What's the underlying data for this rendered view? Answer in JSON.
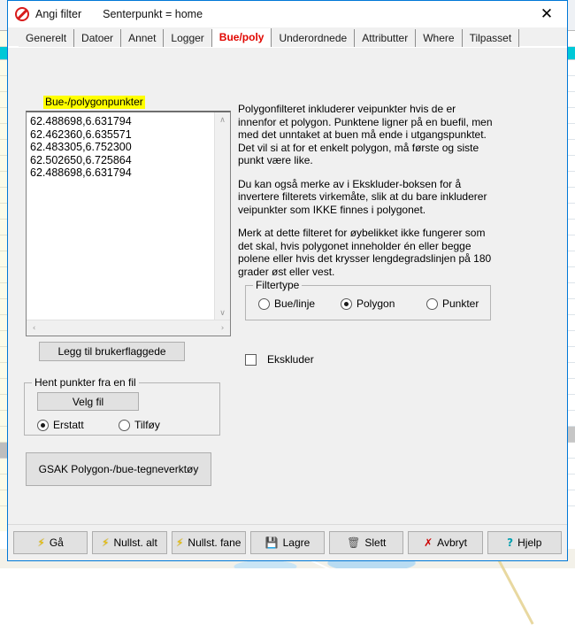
{
  "window": {
    "title": "Angi filter",
    "subtitle": "Senterpunkt = home",
    "app_icon": "no-entry-icon",
    "close_label": "✕",
    "border_color": "#0078d7"
  },
  "tabs": [
    {
      "label": "Generelt",
      "selected": false
    },
    {
      "label": "Datoer",
      "selected": false
    },
    {
      "label": "Annet",
      "selected": false
    },
    {
      "label": "Logger",
      "selected": false
    },
    {
      "label": "Bue/poly",
      "selected": true
    },
    {
      "label": "Underordnede",
      "selected": false
    },
    {
      "label": "Attributter",
      "selected": false
    },
    {
      "label": "Where",
      "selected": false
    },
    {
      "label": "Tilpasset",
      "selected": false
    }
  ],
  "selected_tab_color": "#e10600",
  "points": {
    "label": "Bue-/polygonpunkter",
    "label_highlight_color": "#ffff00",
    "values": [
      "62.488698,6.631794",
      "62.462360,6.635571",
      "62.483305,6.752300",
      "62.502650,6.725864",
      "62.488698,6.631794"
    ],
    "scroll_up": "∧",
    "scroll_down": "∨",
    "scroll_left": "‹",
    "scroll_right": "›"
  },
  "buttons": {
    "add_userflagged": "Legg til brukerflaggede",
    "choose_file": "Velg fil",
    "gsak_tool": "GSAK Polygon-/bue-tegneverktøy"
  },
  "file_group": {
    "title": "Hent punkter fra en fil",
    "options": [
      {
        "label": "Erstatt",
        "selected": true
      },
      {
        "label": "Tilføy",
        "selected": false
      }
    ]
  },
  "filter_type": {
    "title": "Filtertype",
    "options": [
      {
        "label": "Bue/linje",
        "selected": false
      },
      {
        "label": "Polygon",
        "selected": true
      },
      {
        "label": "Punkter",
        "selected": false
      }
    ]
  },
  "exclude": {
    "label": "Ekskluder",
    "checked": false
  },
  "help_text": {
    "p1": "Polygonfilteret inkluderer veipunkter hvis de er innenfor et polygon. Punktene ligner på en buefil, men med det unntaket at buen må ende i utgangspunktet. Det vil si at for et enkelt polygon, må første og siste punkt være like.",
    "p2": "Du kan også merke av i Ekskluder-boksen for å invertere filterets virkemåte, slik at du bare inkluderer veipunkter som IKKE finnes i polygonet.",
    "p3": "Merk at dette filteret for øybelikket ikke fungerer som det skal, hvis polygonet inneholder én eller begge polene eller hvis det krysser lengdegradslinjen på 180 grader øst eller vest."
  },
  "bottom_bar": [
    {
      "label": "Gå",
      "icon": "lightning-icon"
    },
    {
      "label": "Nullst. alt",
      "icon": "lightning-icon"
    },
    {
      "label": "Nullst. fane",
      "icon": "lightning-icon"
    },
    {
      "label": "Lagre",
      "icon": "floppy-disk-icon"
    },
    {
      "label": "Slett",
      "icon": "trash-icon"
    },
    {
      "label": "Avbryt",
      "icon": "red-x-icon"
    },
    {
      "label": "Hjelp",
      "icon": "question-mark-icon"
    }
  ]
}
